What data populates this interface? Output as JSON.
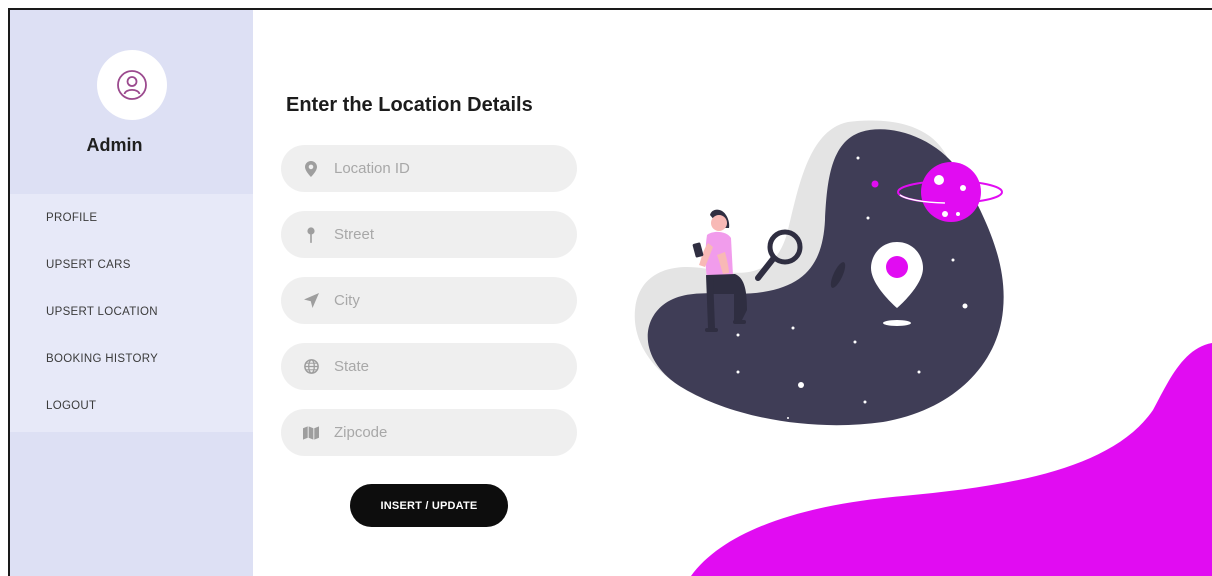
{
  "sidebar": {
    "user_name": "Admin",
    "items": [
      {
        "label": "PROFILE"
      },
      {
        "label": "UPSERT CARS"
      },
      {
        "label": "UPSERT LOCATION"
      },
      {
        "label": "BOOKING HISTORY"
      },
      {
        "label": "LOGOUT"
      }
    ]
  },
  "form": {
    "title": "Enter the Location Details",
    "fields": [
      {
        "placeholder": "Location ID",
        "icon": "map-marker-icon",
        "value": ""
      },
      {
        "placeholder": "Street",
        "icon": "pin-icon",
        "value": ""
      },
      {
        "placeholder": "City",
        "icon": "location-arrow-icon",
        "value": ""
      },
      {
        "placeholder": "State",
        "icon": "globe-icon",
        "value": ""
      },
      {
        "placeholder": "Zipcode",
        "icon": "map-icon",
        "value": ""
      }
    ],
    "submit_label": "INSERT / UPDATE"
  },
  "colors": {
    "sidebar_bg": "#dde0f4",
    "nav_bg": "#e7e9f8",
    "accent": "#e10cf2",
    "dark_blob": "#3f3d56",
    "field_bg": "#efefef",
    "button_bg": "#0d0d0d"
  }
}
